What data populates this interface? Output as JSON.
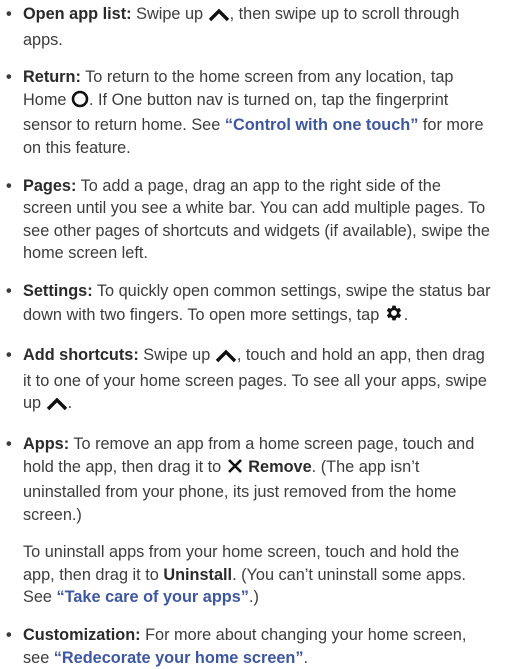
{
  "items": [
    {
      "bullet": "•",
      "term": "Open app list:",
      "t1": " Swipe up ",
      "t2": ", then swipe up to scroll through apps."
    },
    {
      "bullet": "•",
      "term": "Return:",
      "t1": " To return to the home screen from any location, tap Home ",
      "t2": ". If One button nav is turned on, tap the fingerprint sensor to return home. See ",
      "link": "“Control with one touch”",
      "t3": " for more on this feature."
    },
    {
      "bullet": "•",
      "term": "Pages:",
      "t1": " To add a page, drag an app to the right side of the screen until you see a white bar. You can add multiple pages. To see other pages of shortcuts and widgets (if available), swipe the home screen left."
    },
    {
      "bullet": "•",
      "term": "Settings:",
      "t1": " To quickly open common settings, swipe the status bar down with two fingers. To open more settings, tap ",
      "t2": "."
    },
    {
      "bullet": "•",
      "term": "Add shortcuts:",
      "t1": " Swipe up ",
      "t2": ", touch and hold an app, then drag it to one of your home screen pages. To see all your apps, swipe up ",
      "t3": "."
    },
    {
      "bullet": "•",
      "term": "Apps:",
      "t1": " To remove an app from a home screen page, touch and hold the app, then drag it to ",
      "strong": "Remove",
      "t2": ". (The app isn’t uninstalled from your phone, its just removed from the home screen.)"
    },
    {
      "para_t1": "To uninstall apps from your home screen, touch and hold the app, then drag it to ",
      "para_strong": "Uninstall",
      "para_t2": ". (You can’t uninstall some apps. See ",
      "para_link": "“Take care of your apps”",
      "para_t3": ".)"
    },
    {
      "bullet": "•",
      "term": "Customization:",
      "t1": " For more about changing your home screen, see ",
      "link": "“Redecorate your home screen”",
      "t2": "."
    }
  ],
  "icons": {
    "swipe_up": "chevron-up-icon",
    "home": "home-circle-icon",
    "settings": "gear-icon",
    "remove": "close-x-icon"
  },
  "colors": {
    "text": "#3c3c3c",
    "link": "#3d57a1"
  }
}
